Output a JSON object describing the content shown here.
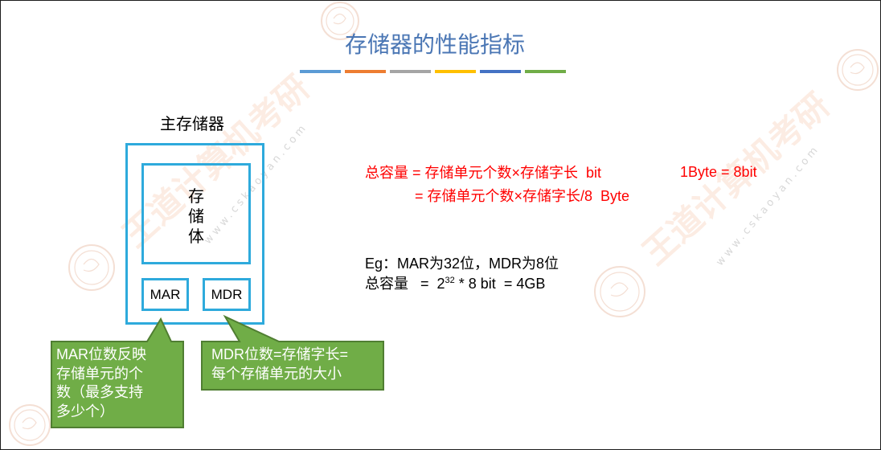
{
  "slide": {
    "title": "存储器的性能指标",
    "title_color": "#4A76B4",
    "title_bar_colors": [
      "#5B9BD5",
      "#ED7D31",
      "#A5A5A5",
      "#FFC000",
      "#4472C4",
      "#70AD47"
    ]
  },
  "diagram": {
    "label": "主存储器",
    "storage_body": [
      "存",
      "储",
      "体"
    ],
    "mar": "MAR",
    "mdr": "MDR",
    "box_color": "#2EAADC"
  },
  "callouts": {
    "mar_lines": [
      "MAR位数反映",
      "存储单元的个",
      "数（最多支持",
      "多少个）"
    ],
    "mdr_lines": [
      "MDR位数=存储字长=",
      "每个存储单元的大小"
    ],
    "fill_color": "#70AD47",
    "border_color": "#507E32"
  },
  "formula": {
    "line1": "总容量 = 存储单元个数×存储字长  bit",
    "line2": "= 存储单元个数×存储字长/8  Byte",
    "byte_note": "1Byte = 8bit",
    "color": "#FF0000"
  },
  "example": {
    "line1": "Eg：MAR为32位，MDR为8位",
    "line2_before": "总容量   =  2",
    "exponent": "32",
    "line2_after": " * 8 bit  = 4GB"
  },
  "watermark": {
    "text": "王道计算机考研",
    "url": "www.cskaoyan.com"
  }
}
